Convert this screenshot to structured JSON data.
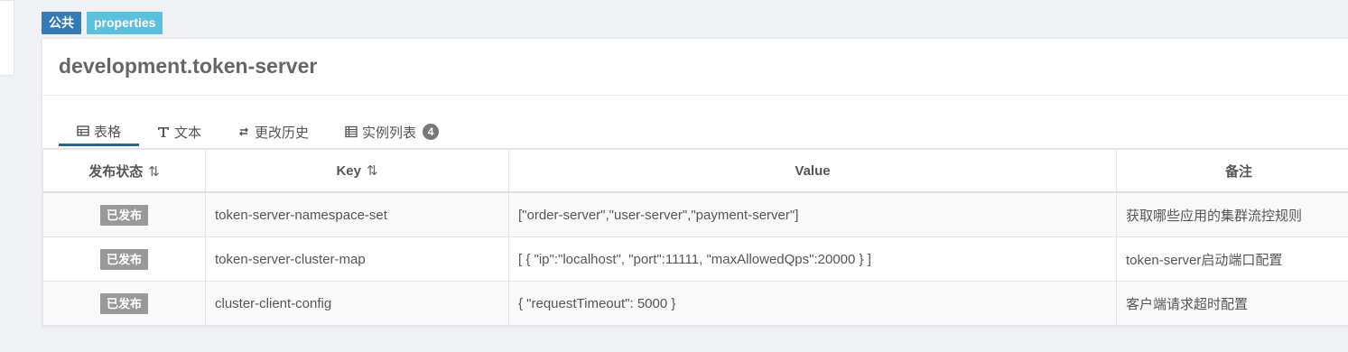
{
  "labels": {
    "scope": "公共",
    "format": "properties"
  },
  "namespace": {
    "title": "development.token-server"
  },
  "tabs": [
    {
      "label": "表格",
      "icon": "table-icon",
      "active": true
    },
    {
      "label": "文本",
      "icon": "text-icon",
      "active": false
    },
    {
      "label": "更改历史",
      "icon": "history-icon",
      "active": false
    },
    {
      "label": "实例列表",
      "icon": "instance-list-icon",
      "active": false,
      "badge": "4"
    }
  ],
  "table": {
    "columns": {
      "status": "发布状态",
      "key": "Key",
      "value": "Value",
      "comment": "备注"
    },
    "sort_icon": "⇅",
    "rows": [
      {
        "status": "已发布",
        "key": "token-server-namespace-set",
        "value": "[\"order-server\",\"user-server\",\"payment-server\"]",
        "comment": "获取哪些应用的集群流控规则"
      },
      {
        "status": "已发布",
        "key": "token-server-cluster-map",
        "value": "[ { \"ip\":\"localhost\", \"port\":11111, \"maxAllowedQps\":20000 } ]",
        "comment": "token-server启动端口配置"
      },
      {
        "status": "已发布",
        "key": "cluster-client-config",
        "value": "{ \"requestTimeout\": 5000 }",
        "comment": "客户端请求超时配置"
      }
    ]
  },
  "colors": {
    "scope_label": "#337ab7",
    "format_label": "#5bc0de",
    "status_badge": "#999999",
    "active_tab": "#2a6592"
  }
}
